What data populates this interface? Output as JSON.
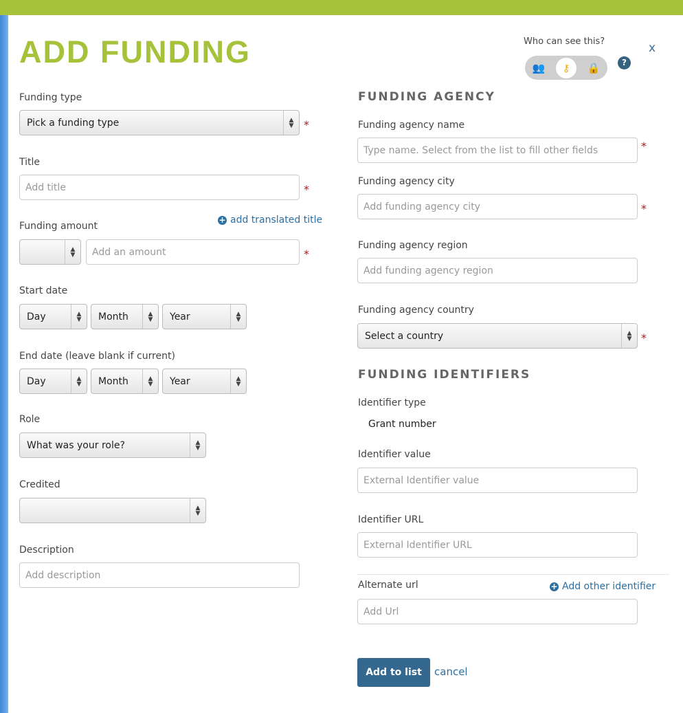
{
  "header": {
    "title": "ADD FUNDING",
    "visibility_label": "Who can see this?",
    "close_label": "x",
    "help_label": "?"
  },
  "privacy_options": [
    {
      "icon": "group-icon",
      "glyph": "👥"
    },
    {
      "icon": "key-icon",
      "glyph": "⚷",
      "selected": true
    },
    {
      "icon": "lock-icon",
      "glyph": "🔒"
    }
  ],
  "left": {
    "funding_type": {
      "label": "Funding type",
      "value": "Pick a funding type"
    },
    "title": {
      "label": "Title",
      "placeholder": "Add title"
    },
    "translated_link": "add translated title",
    "amount": {
      "label": "Funding amount",
      "currency_value": "",
      "placeholder": "Add an amount"
    },
    "start_date": {
      "label": "Start date",
      "day": "Day",
      "month": "Month",
      "year": "Year"
    },
    "end_date": {
      "label": "End date (leave blank if current)",
      "day": "Day",
      "month": "Month",
      "year": "Year"
    },
    "role": {
      "label": "Role",
      "value": "What was your role?"
    },
    "credited": {
      "label": "Credited",
      "value": ""
    },
    "description": {
      "label": "Description",
      "placeholder": "Add description"
    }
  },
  "right": {
    "agency_heading": "FUNDING AGENCY",
    "agency_name": {
      "label": "Funding agency name",
      "placeholder": "Type name. Select from the list to fill other fields"
    },
    "agency_city": {
      "label": "Funding agency city",
      "placeholder": "Add funding agency city"
    },
    "agency_region": {
      "label": "Funding agency region",
      "placeholder": "Add funding agency region"
    },
    "agency_country": {
      "label": "Funding agency country",
      "value": "Select a country"
    },
    "identifiers_heading": "FUNDING IDENTIFIERS",
    "identifier_type": {
      "label": "Identifier type",
      "value": "Grant number"
    },
    "identifier_value": {
      "label": "Identifier value",
      "placeholder": "External Identifier value"
    },
    "identifier_url": {
      "label": "Identifier URL",
      "placeholder": "External Identifier URL"
    },
    "alternate_url": {
      "label": "Alternate url",
      "placeholder": "Add Url"
    },
    "add_identifier_link": "Add other identifier"
  },
  "actions": {
    "add_label": "Add to list",
    "cancel_label": "cancel"
  },
  "required_mark": "*",
  "colors": {
    "accent_green": "#a6c23a",
    "button_blue": "#35688f",
    "link_blue": "#2b6fa3",
    "required_red": "#a02020"
  }
}
